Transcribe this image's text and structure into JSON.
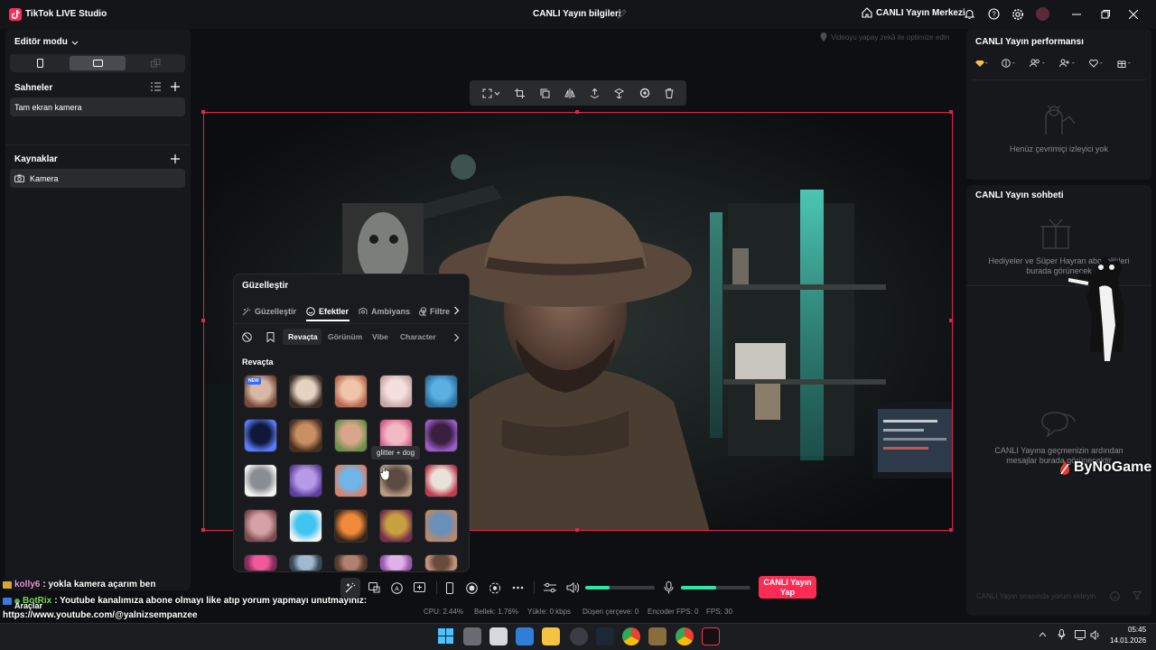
{
  "app": {
    "title": "TikTok LIVE Studio",
    "center_title": "CANLI Yayın bilgileri",
    "center_link": "CANLI Yayın Merkezi"
  },
  "left": {
    "editor_mode": "Editör modu",
    "scenes_label": "Sahneler",
    "scene_item": "Tam ekran kamera",
    "sources_label": "Kaynaklar",
    "source_item": "Kamera"
  },
  "canvas": {
    "hint": "Videoyu yapay zekâ ile optimize edin"
  },
  "fx": {
    "title": "Güzelleştir",
    "tabs": [
      "Güzelleştir",
      "Efektler",
      "Ambiyans",
      "Filtre"
    ],
    "subtabs": [
      "Revaçta",
      "Görünüm",
      "Vibe",
      "Character"
    ],
    "section": "Revaçta",
    "tile_badge": "NEW",
    "tooltip": "glitter + dog"
  },
  "right": {
    "perf_title": "CANLI Yayın performansı",
    "perf_empty": "Henüz çevrimiçi izleyici yok",
    "chat_title": "CANLI Yayın sohbeti",
    "gifts_text": "Hediyeler ve Süper Hayran abonelikleri burada görünecek",
    "chat_empty": "CANLI Yayına geçmenizin ardından mesajlar burada görünecektir",
    "chat_placeholder": "CANLI Yayın sırasında yorum ekleyin"
  },
  "controls": {
    "golive": "CANLI Yayın Yap",
    "tools": "Araçlar"
  },
  "stats": {
    "cpu": "CPU: 2.44%",
    "mem": "Bellek: 1.76%",
    "upload": "Yükle: 0 kbps",
    "dropped": "Düşen çerçeve: 0",
    "encoder": "Encoder FPS: 0",
    "fps": "FPS: 30"
  },
  "chat": {
    "line1_user": "kolly6",
    "line1_text": " : yokla kamera açarım ben",
    "line2_user": "BotRix",
    "line2_text": " : Youtube kanalımıza abone olmayı like atıp yorum yapmayı unutmayınız:",
    "line3": "https://www.youtube.com/@yalnizsempanzee"
  },
  "watermark": "ByNoGame",
  "taskbar": {
    "time": "05:45",
    "date": "14.01.2026"
  },
  "colors": {
    "accent": "#fe2c55",
    "selection": "#e0244f",
    "bg": "#0e0f12",
    "panel": "#17181b",
    "slider": "#2ee6a8"
  }
}
